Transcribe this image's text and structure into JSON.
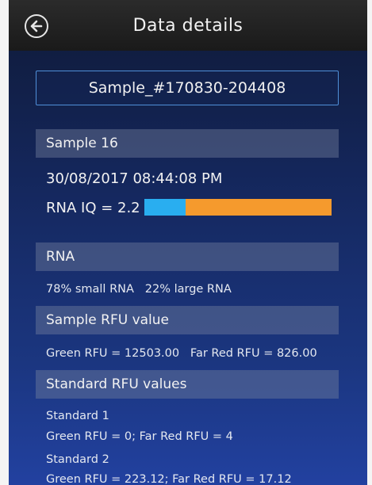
{
  "header": {
    "title": "Data details",
    "back_icon": "back-arrow-circle-icon"
  },
  "sample_name": "Sample_#170830-204408",
  "sample_section": {
    "label": "Sample 16",
    "datetime": "30/08/2017 08:44:08 PM",
    "rna_iq_text": "RNA IQ = 2.2"
  },
  "rna_iq_bar": {
    "small_rna_fraction": 0.22,
    "large_rna_fraction": 0.78,
    "small_color": "#29aef0",
    "large_color": "#f59a2d"
  },
  "rna_section": {
    "label": "RNA",
    "composition": "78% small RNA   22% large RNA"
  },
  "sample_rfu_section": {
    "label": "Sample RFU value",
    "values": "Green RFU = 12503.00   Far Red RFU = 826.00"
  },
  "standard_rfu_section": {
    "label": "Standard RFU values",
    "standard1_name": "Standard 1",
    "standard1_values": "Green RFU = 0; Far Red RFU = 4",
    "standard2_name": "Standard 2",
    "standard2_values": "Green RFU = 223.12; Far Red RFU = 17.12"
  }
}
